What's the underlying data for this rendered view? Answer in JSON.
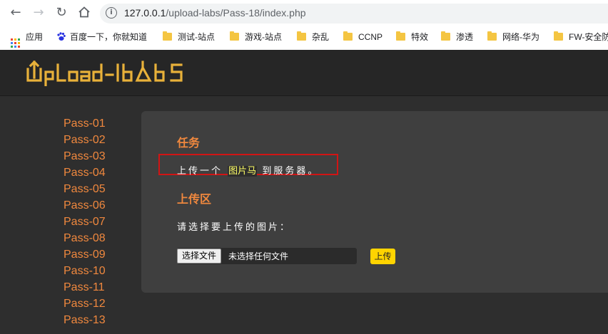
{
  "browser": {
    "url_host": "127.0.0.1",
    "url_path": "/upload-labs/Pass-18/index.php",
    "bookmarks": [
      {
        "label": "应用",
        "icon": "apps-grid-icon"
      },
      {
        "label": "百度一下，你就知道",
        "icon": "baidu-paw-icon"
      },
      {
        "label": "测试-站点",
        "icon": "folder-icon"
      },
      {
        "label": "游戏-站点",
        "icon": "folder-icon"
      },
      {
        "label": "杂乱",
        "icon": "folder-icon"
      },
      {
        "label": "CCNP",
        "icon": "folder-icon"
      },
      {
        "label": "特效",
        "icon": "folder-icon"
      },
      {
        "label": "渗透",
        "icon": "folder-icon"
      },
      {
        "label": "网络-华为",
        "icon": "folder-icon"
      },
      {
        "label": "FW-安全防",
        "icon": "folder-icon"
      }
    ]
  },
  "site": {
    "logo": "UpLoad-labs",
    "passes": [
      "Pass-01",
      "Pass-02",
      "Pass-03",
      "Pass-04",
      "Pass-05",
      "Pass-06",
      "Pass-07",
      "Pass-08",
      "Pass-09",
      "Pass-10",
      "Pass-11",
      "Pass-12",
      "Pass-13"
    ]
  },
  "task": {
    "heading": "任务",
    "text_before": "上传一个",
    "highlight": "图片马",
    "text_after": "到服务器。"
  },
  "upload": {
    "heading": "上传区",
    "prompt": "请选择要上传的图片：",
    "choose_label": "选择文件",
    "no_file_text": "未选择任何文件",
    "submit_label": "上传"
  },
  "colors": {
    "accent_orange": "#f0883e",
    "logo_gold": "#e8b13a",
    "upload_button": "#ffd400",
    "highlight_box": "#d11414"
  }
}
